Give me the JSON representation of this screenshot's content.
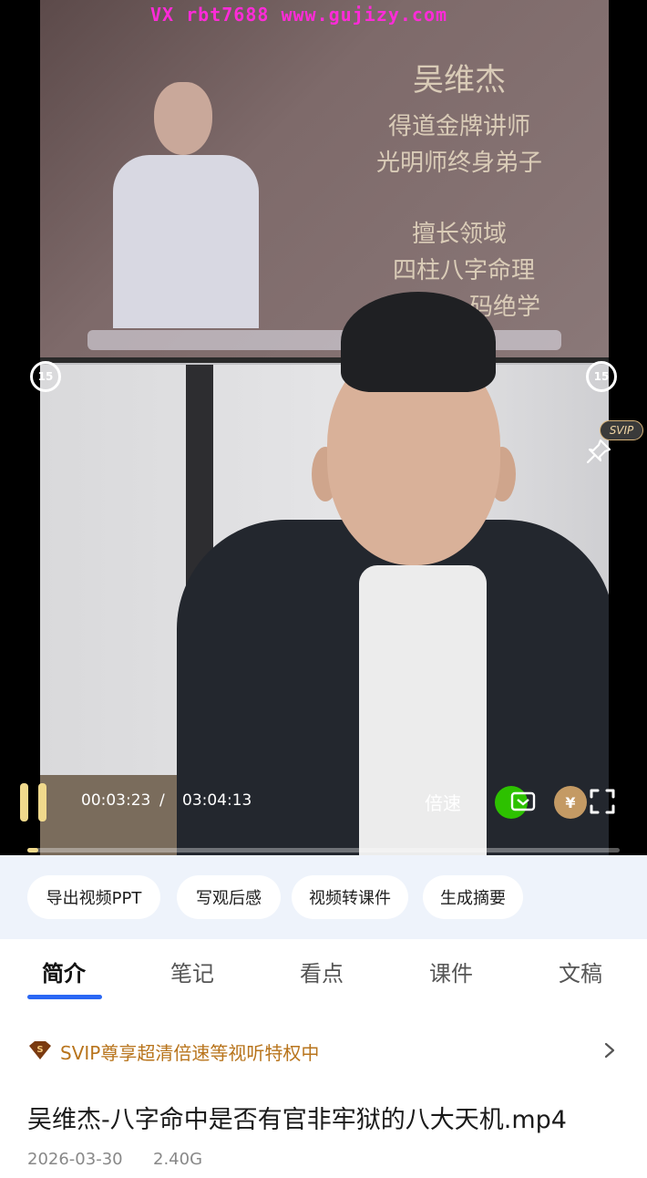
{
  "watermark": "VX rbt7688 www.gujizy.com",
  "screen": {
    "name": "吴维杰",
    "lines": [
      "得道金牌讲师",
      "光明师终身弟子",
      "擅长领域",
      "四柱八字命理"
    ],
    "line_partial": "码绝学"
  },
  "player": {
    "skip_back": "15",
    "skip_forward": "15",
    "svip_tag": "SVIP",
    "current_time": "00:03:23",
    "separator": "/",
    "total_time": "03:04:13",
    "speed_label": "倍速",
    "coin_symbol": "¥",
    "progress": 0.018
  },
  "chips": [
    "导出视频PPT",
    "写观后感",
    "视频转课件",
    "生成摘要"
  ],
  "tabs": [
    "简介",
    "笔记",
    "看点",
    "课件",
    "文稿"
  ],
  "active_tab": "简介",
  "svip_banner": {
    "badge": "S",
    "text": "SVIP尊享超清倍速等视听特权中"
  },
  "file": {
    "title": "吴维杰-八字命中是否有官非牢狱的八大天机.mp4",
    "date": "2026-03-30",
    "size": "2.40G"
  },
  "colors": {
    "accent_blue": "#2a67f4",
    "svip_gold": "#b8741c",
    "watermark_pink": "#ff2bd8",
    "chip_bg": "#eef3fb"
  }
}
